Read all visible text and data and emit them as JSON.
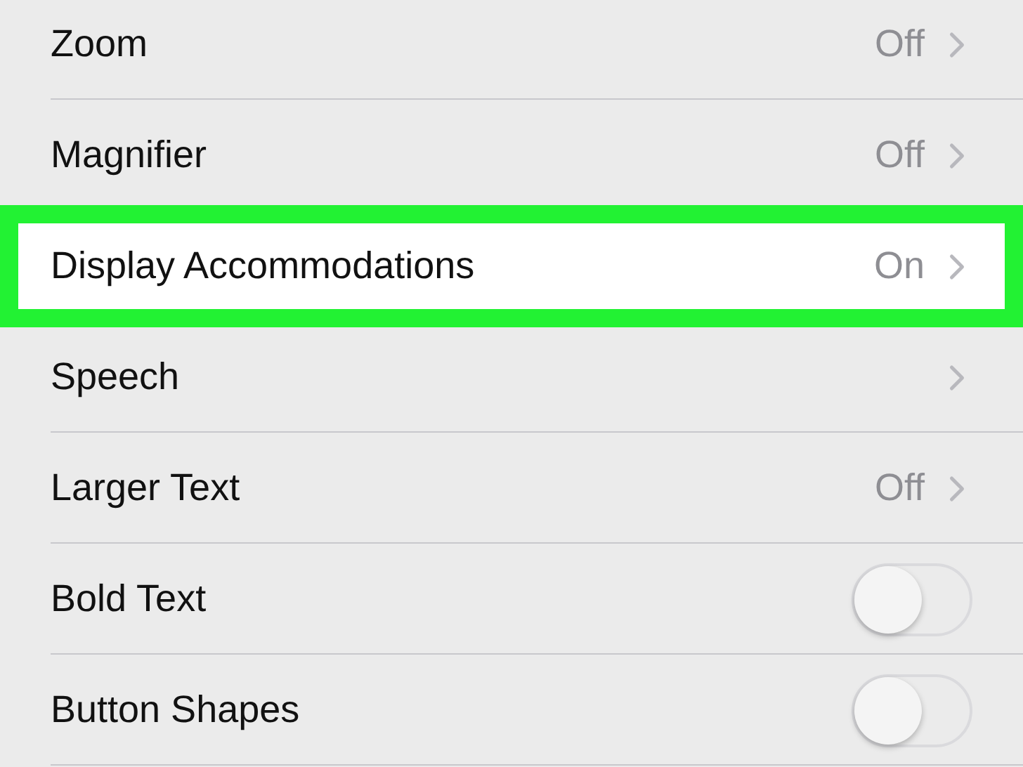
{
  "rows": [
    {
      "kind": "link",
      "label": "Zoom",
      "value": "Off",
      "highlighted": false
    },
    {
      "kind": "link",
      "label": "Magnifier",
      "value": "Off",
      "highlighted": false
    },
    {
      "kind": "link",
      "label": "Display Accommodations",
      "value": "On",
      "highlighted": true
    },
    {
      "kind": "link",
      "label": "Speech",
      "highlighted": false
    },
    {
      "kind": "link",
      "label": "Larger Text",
      "value": "Off",
      "highlighted": false
    },
    {
      "kind": "toggle",
      "label": "Bold Text",
      "on": false,
      "highlighted": false
    },
    {
      "kind": "toggle",
      "label": "Button Shapes",
      "on": false,
      "highlighted": false
    }
  ]
}
